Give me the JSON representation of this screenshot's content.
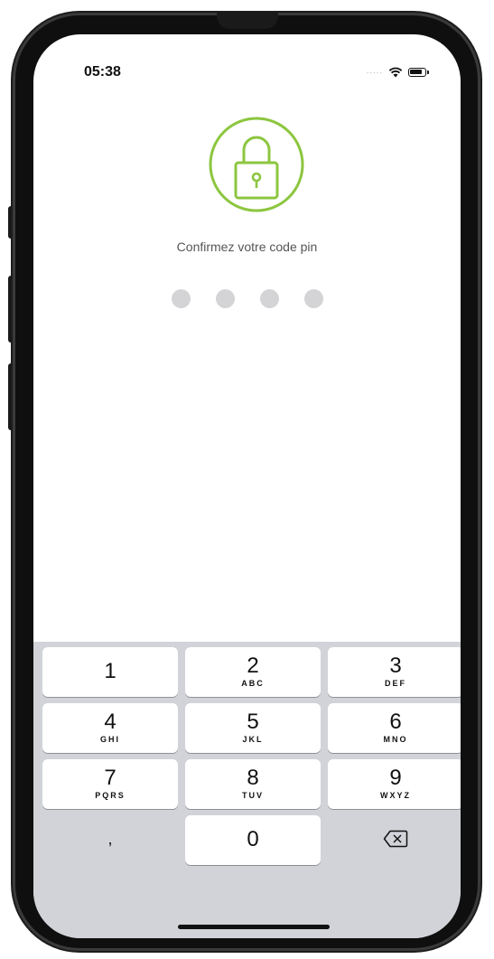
{
  "status_bar": {
    "time": "05:38",
    "signal": "·····",
    "wifi_icon": "wifi-icon",
    "battery_icon": "battery-icon"
  },
  "lock": {
    "icon": "lock-icon",
    "accent_color": "#8cc63f"
  },
  "prompt": "Confirmez votre code pin",
  "pin": {
    "length": 4,
    "entered": 0
  },
  "keypad": {
    "keys": [
      {
        "digit": "1",
        "letters": ""
      },
      {
        "digit": "2",
        "letters": "ABC"
      },
      {
        "digit": "3",
        "letters": "DEF"
      },
      {
        "digit": "4",
        "letters": "GHI"
      },
      {
        "digit": "5",
        "letters": "JKL"
      },
      {
        "digit": "6",
        "letters": "MNO"
      },
      {
        "digit": "7",
        "letters": "PQRS"
      },
      {
        "digit": "8",
        "letters": "TUV"
      },
      {
        "digit": "9",
        "letters": "WXYZ"
      }
    ],
    "comma": ",",
    "zero": "0",
    "delete_icon": "backspace-icon"
  }
}
